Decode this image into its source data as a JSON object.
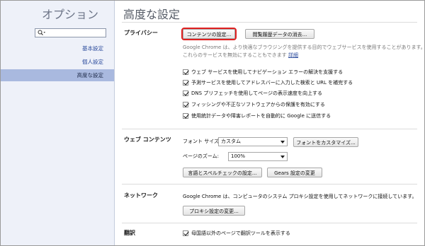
{
  "sidebar": {
    "title": "オプション",
    "search": {
      "value": "",
      "icon": "search-icon"
    },
    "items": [
      {
        "label": "基本設定",
        "active": false
      },
      {
        "label": "個人設定",
        "active": false
      },
      {
        "label": "高度な設定",
        "active": true
      }
    ]
  },
  "main": {
    "title": "高度な設定",
    "privacy": {
      "label": "プライバシー",
      "content_settings_button": "コンテンツの設定...",
      "clear_history_button": "閲覧履歴データの消去...",
      "desc_line1": "Google Chrome は、より快適なブラウジングを提供する目的でウェブサービスを使用することがあります。",
      "desc_line2": "これらのサービスを無効にすることもできます",
      "desc_link": "詳細",
      "checkboxes": [
        "ウェブ サービスを使用してナビゲーション エラーの解決を支援する",
        "予測サービスを使用してアドレスバーに入力した検索と URL を補完する",
        "DNS プリフェッチを使用してページの表示速度を向上する",
        "フィッシングや不正なソフトウェアからの保護を有効にする",
        "使用統計データや障害レポートを自動的に Google に送信する"
      ]
    },
    "web_content": {
      "label": "ウェブ コンテンツ",
      "font_size_label": "フォント サイズ:",
      "font_size_value": "カスタム",
      "customize_fonts_button": "フォントをカスタマイズ...",
      "zoom_label": "ページのズーム:",
      "zoom_value": "100%",
      "language_spell_button": "言語とスペルチェックの設定...",
      "gears_button": "Gears 設定の変更"
    },
    "network": {
      "label": "ネットワーク",
      "desc": "Google Chrome は、コンピュータのシステム プロキシ設定を使用してネットワークに接続しています。",
      "proxy_button": "プロキシ設定の変更..."
    },
    "translate": {
      "label": "翻訳",
      "checkbox": "母国語以外のページで翻訳ツールを表示する"
    }
  }
}
